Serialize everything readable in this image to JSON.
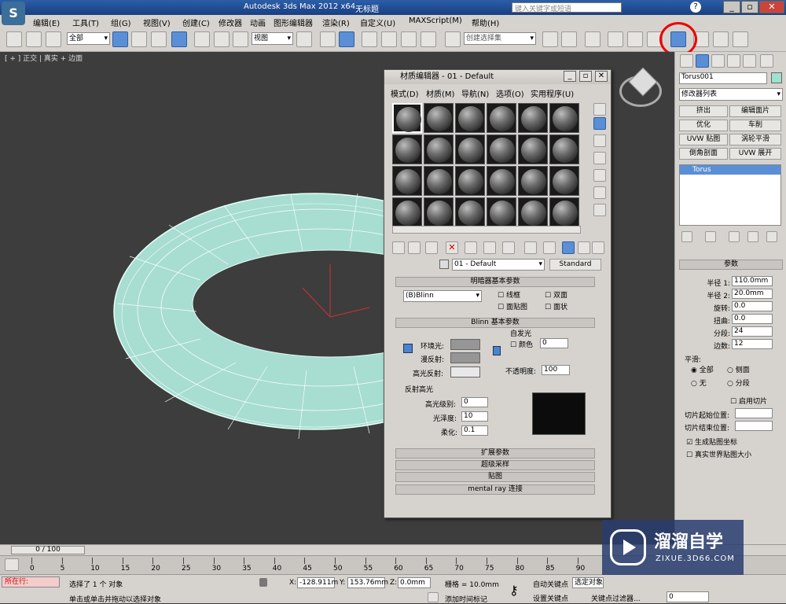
{
  "titlebar": {
    "app_title": "Autodesk 3ds Max  2012 x64",
    "doc_title": "无标题",
    "search_placeholder": "键入关键字或短语"
  },
  "menubar": [
    "编辑(E)",
    "工具(T)",
    "组(G)",
    "视图(V)",
    "创建(C)",
    "修改器",
    "动画",
    "图形编辑器",
    "渲染(R)",
    "自定义(U)",
    "MAXScript(M)",
    "帮助(H)"
  ],
  "toolbar": {
    "selection_filter": "全部",
    "ref_coord": "视图",
    "named_selection": "创建选择集"
  },
  "viewport": {
    "label": "[ + ] 正交 | 真实 + 边面"
  },
  "material_editor": {
    "title": "材质编辑器 - 01 - Default",
    "menu": [
      "模式(D)",
      "材质(M)",
      "导航(N)",
      "选项(O)",
      "实用程序(U)"
    ],
    "material_name": "01 - Default",
    "material_type": "Standard",
    "shader_rollout": "明暗器基本参数",
    "shader": "(B)Blinn",
    "shader_options": [
      "线框",
      "双面",
      "面贴图",
      "面状"
    ],
    "blinn_rollout": "Blinn 基本参数",
    "self_illum": "自发光",
    "color_label": "颜色",
    "self_illum_value": "0",
    "ambient": "环境光:",
    "diffuse": "漫反射:",
    "specular": "高光反射:",
    "opacity_label": "不透明度:",
    "opacity": "100",
    "spec_group": "反射高光",
    "spec_level_label": "高光级别:",
    "spec_level": "0",
    "gloss_label": "光泽度:",
    "gloss": "10",
    "soften_label": "柔化:",
    "soften": "0.1",
    "rollouts": [
      "扩展参数",
      "超级采样",
      "贴图",
      "mental ray 连接"
    ]
  },
  "cmdpanel": {
    "object_name": "Torus001",
    "modifier_list": "修改器列表",
    "buttons": [
      "挤出",
      "编辑面片",
      "优化",
      "车削",
      "UVW 贴图",
      "涡轮平滑",
      "倒角剖面",
      "UVW 展开"
    ],
    "stack_item": "Torus",
    "params_title": "参数",
    "params": [
      {
        "label": "半径 1:",
        "value": "110.0mm"
      },
      {
        "label": "半径 2:",
        "value": "20.0mm"
      },
      {
        "label": "旋转:",
        "value": "0.0"
      },
      {
        "label": "扭曲:",
        "value": "0.0"
      },
      {
        "label": "分段:",
        "value": "24"
      },
      {
        "label": "边数:",
        "value": "12"
      }
    ],
    "smooth_title": "平滑:",
    "smooth_opts": [
      "全部",
      "侧面",
      "无",
      "分段"
    ],
    "slice_on": "启用切片",
    "slice_from": "切片起始位置:",
    "slice_to": "切片结束位置:",
    "gen_map": "生成贴图坐标",
    "real_world": "真实世界贴图大小"
  },
  "timeline": {
    "frame": "0 / 100",
    "ticks": [
      "0",
      "5",
      "10",
      "15",
      "20",
      "25",
      "30",
      "35",
      "40",
      "45",
      "50",
      "55",
      "60",
      "65",
      "70",
      "75",
      "80",
      "85",
      "90"
    ]
  },
  "status": {
    "selected": "选择了 1 个 对象",
    "hint": "单击或单击并拖动以选择对象",
    "running": "所在行:",
    "x": "-128.911m",
    "y": "153.76mm",
    "z": "0.0mm",
    "grid": "栅格 = 10.0mm",
    "add_time_tag": "添加时间标记",
    "auto_key": "自动关键点",
    "selected_obj": "选定对象",
    "set_key": "设置关键点",
    "key_filters": "关键点过滤器...",
    "frame_field": "0"
  },
  "watermark": {
    "brand": "溜溜自学",
    "url": "ZIXUE.3D66.COM"
  }
}
